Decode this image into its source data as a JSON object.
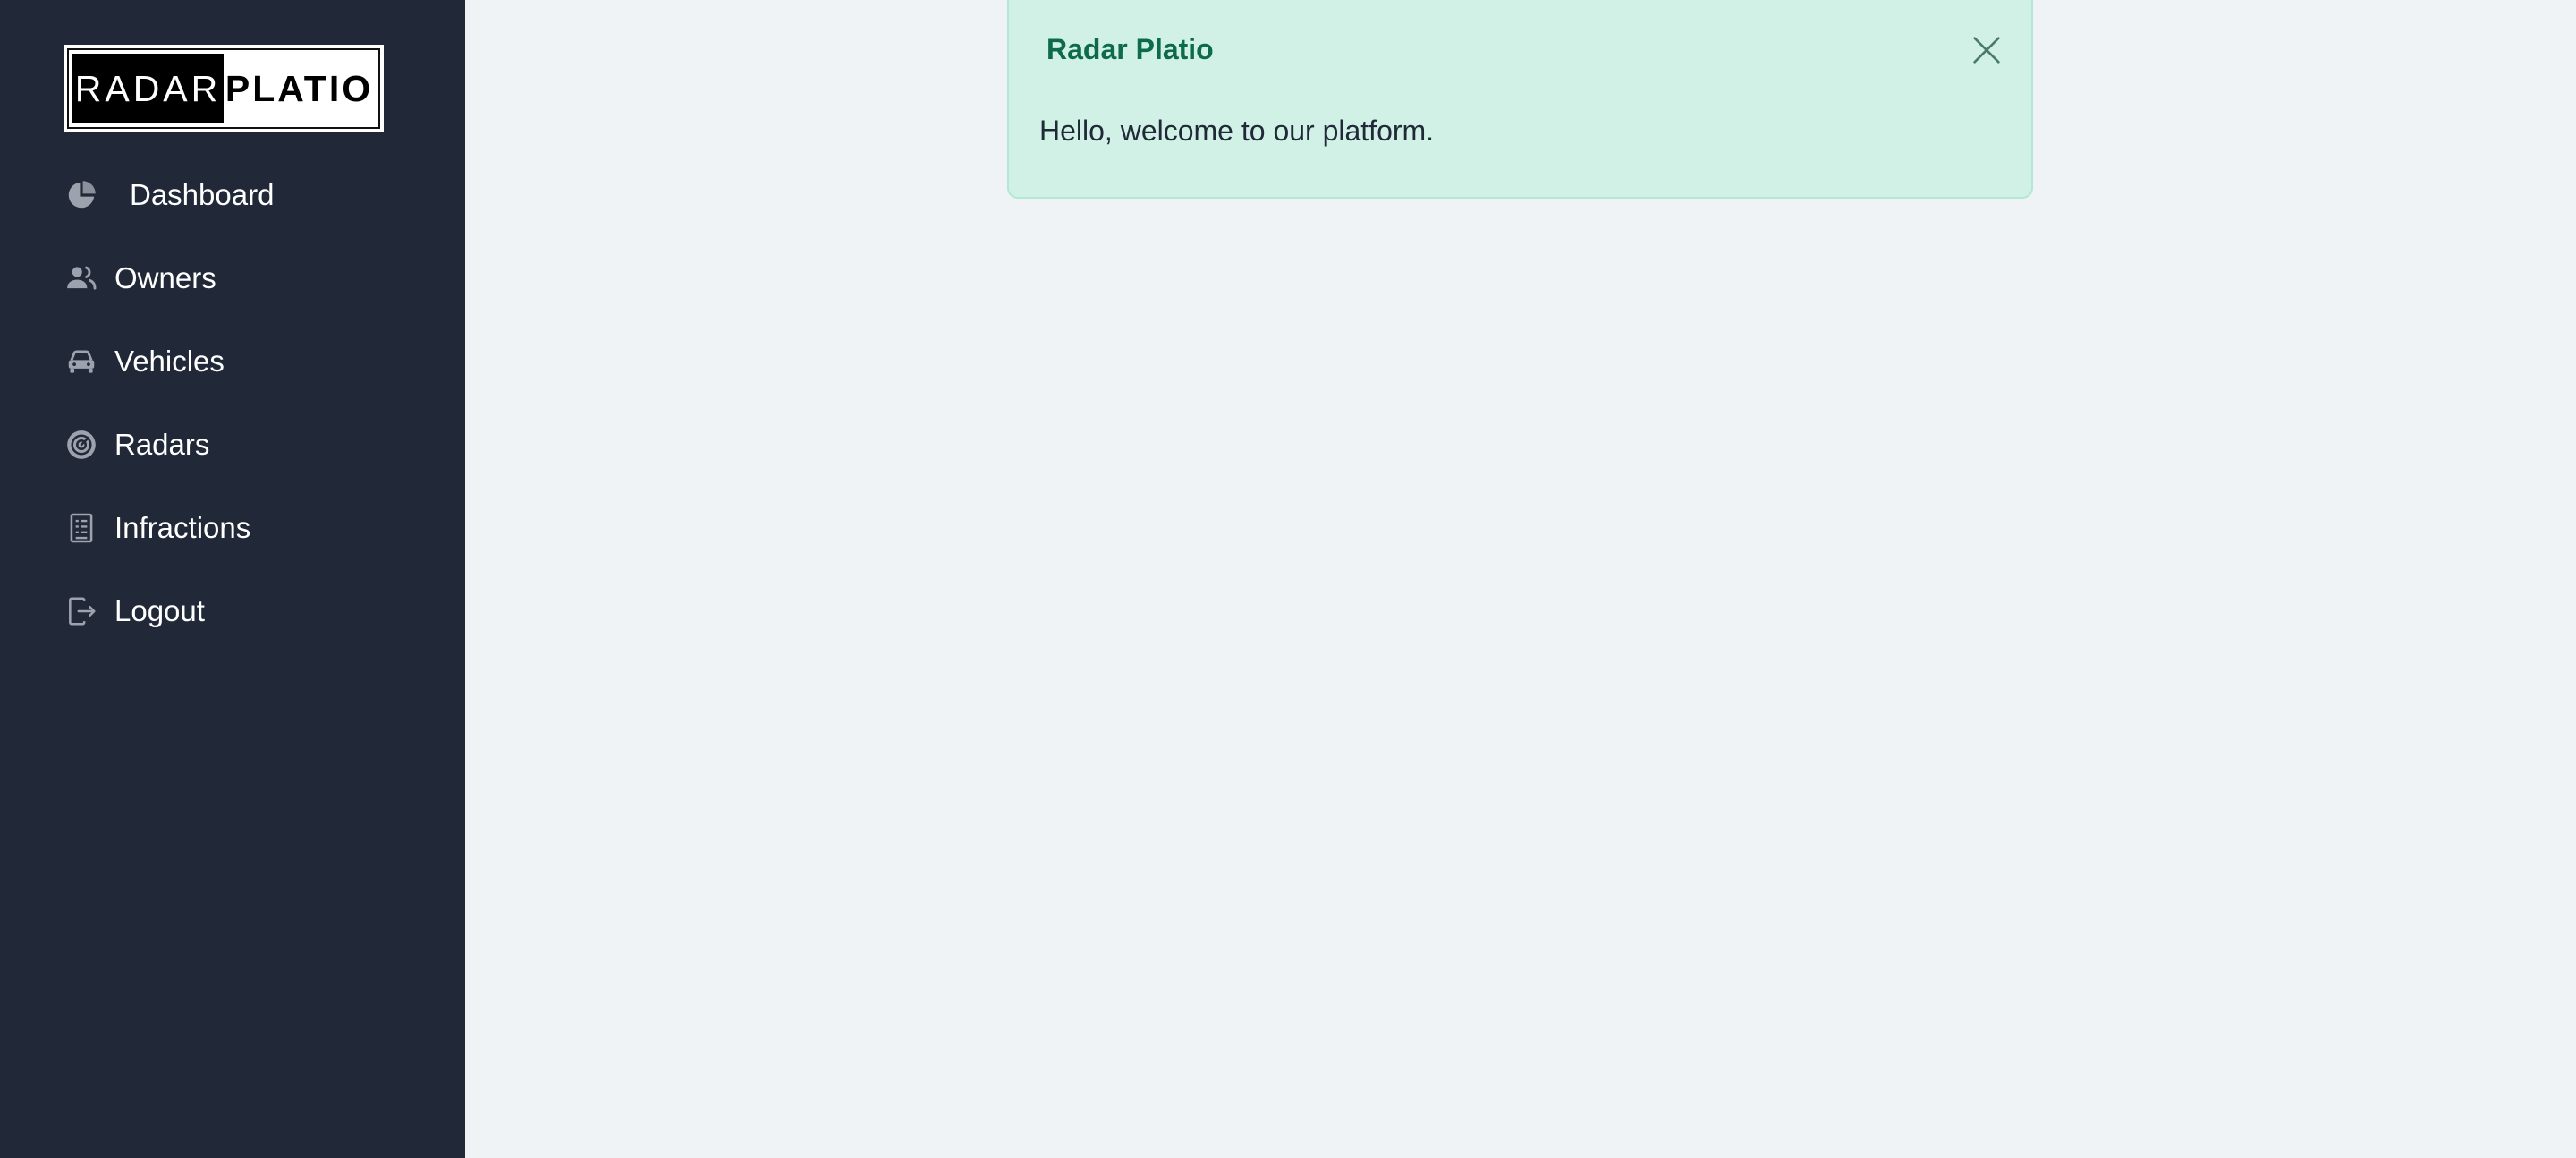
{
  "logo": {
    "left_text": "RADAR",
    "right_text": "PLATIO"
  },
  "sidebar": {
    "items": [
      {
        "label": "Dashboard",
        "icon": "pie-chart-icon"
      },
      {
        "label": "Owners",
        "icon": "users-icon"
      },
      {
        "label": "Vehicles",
        "icon": "car-icon"
      },
      {
        "label": "Radars",
        "icon": "radar-icon"
      },
      {
        "label": "Infractions",
        "icon": "receipt-icon"
      },
      {
        "label": "Logout",
        "icon": "logout-icon"
      }
    ]
  },
  "alert": {
    "title": "Radar Platio",
    "message": "Hello, welcome to our platform."
  },
  "colors": {
    "sidebar_bg": "#212938",
    "page_bg": "#eff3f6",
    "alert_bg": "#d1f1e6",
    "alert_title": "#0d6b4b",
    "icon_gray": "#9ca3af"
  }
}
